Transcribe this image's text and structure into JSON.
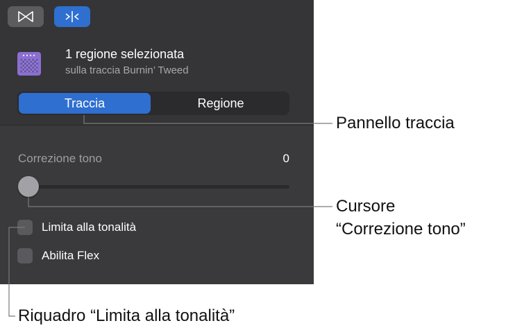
{
  "toolbar": {
    "buttons": [
      {
        "icon": "bowtie-icon",
        "active": false
      },
      {
        "icon": "pitch-correct-icon",
        "active": true
      }
    ]
  },
  "selection": {
    "title": "1 regione selezionata",
    "subtitle": "sulla traccia Burnin’ Tweed",
    "icon": "amp-icon"
  },
  "tabs": [
    {
      "label": "Traccia",
      "active": true
    },
    {
      "label": "Regione",
      "active": false
    }
  ],
  "slider": {
    "label": "Correzione tono",
    "value": "0",
    "fraction": 0
  },
  "checkboxes": [
    {
      "label": "Limita alla tonalità",
      "checked": false
    },
    {
      "label": "Abilita Flex",
      "checked": false
    }
  ],
  "callouts": {
    "panel": "Pannello traccia",
    "slider_line1": "Cursore",
    "slider_line2": "“Correzione tono”",
    "checkbox": "Riquadro “Limita alla tonalità”"
  },
  "colors": {
    "accent": "#2f6fd0",
    "panel": "#3a3a3c"
  }
}
